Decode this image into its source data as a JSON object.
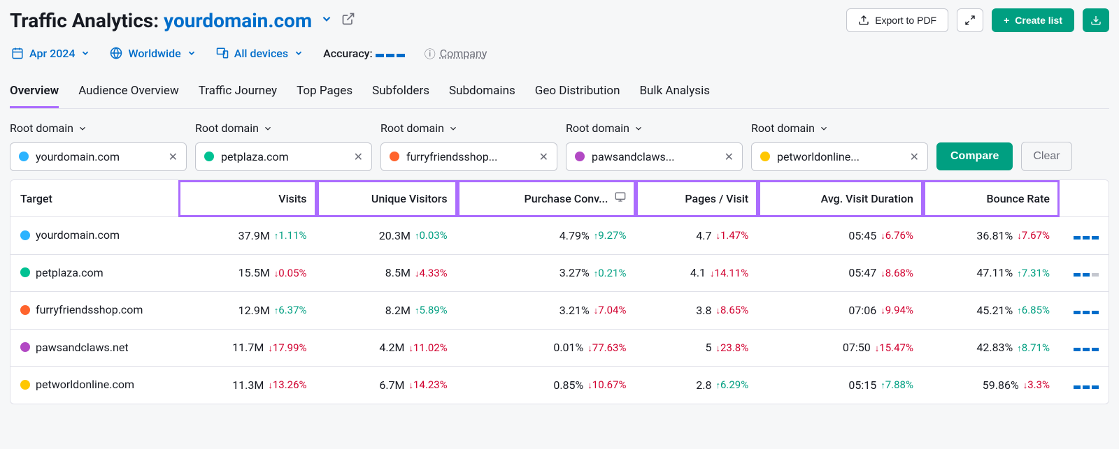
{
  "header": {
    "title_prefix": "Traffic Analytics: ",
    "domain": "yourdomain.com",
    "export_label": "Export to PDF",
    "create_list_label": "Create list"
  },
  "filters": {
    "date": "Apr 2024",
    "region": "Worldwide",
    "devices": "All devices",
    "accuracy_label": "Accuracy:",
    "company_label": "Company"
  },
  "tabs": [
    {
      "label": "Overview",
      "active": true
    },
    {
      "label": "Audience Overview"
    },
    {
      "label": "Traffic Journey"
    },
    {
      "label": "Top Pages"
    },
    {
      "label": "Subfolders"
    },
    {
      "label": "Subdomains"
    },
    {
      "label": "Geo Distribution"
    },
    {
      "label": "Bulk Analysis"
    }
  ],
  "domain_selector": {
    "root_label": "Root domain",
    "chips": [
      {
        "label": "yourdomain.com",
        "color": "#2bb3ff"
      },
      {
        "label": "petplaza.com",
        "color": "#00c192"
      },
      {
        "label": "furryfriendsshop...",
        "color": "#ff642d"
      },
      {
        "label": "pawsandclaws...",
        "color": "#b249c4"
      },
      {
        "label": "petworldonline...",
        "color": "#ffc700"
      }
    ],
    "compare_label": "Compare",
    "clear_label": "Clear"
  },
  "table": {
    "headers": {
      "target": "Target",
      "visits": "Visits",
      "unique": "Unique Visitors",
      "conv": "Purchase Conv...",
      "pages": "Pages / Visit",
      "duration": "Avg. Visit Duration",
      "bounce": "Bounce Rate"
    },
    "rows": [
      {
        "color": "#2bb3ff",
        "domain": "yourdomain.com",
        "visits": {
          "v": "37.9M",
          "d": "1.11%",
          "dir": "up"
        },
        "unique": {
          "v": "20.3M",
          "d": "0.03%",
          "dir": "up"
        },
        "conv": {
          "v": "4.79%",
          "d": "9.27%",
          "dir": "up"
        },
        "pages": {
          "v": "4.7",
          "d": "1.47%",
          "dir": "down"
        },
        "duration": {
          "v": "05:45",
          "d": "6.76%",
          "dir": "down"
        },
        "bounce": {
          "v": "36.81%",
          "d": "7.67%",
          "dir": "down"
        },
        "spark": [
          1,
          1,
          1
        ]
      },
      {
        "color": "#00c192",
        "domain": "petplaza.com",
        "visits": {
          "v": "15.5M",
          "d": "0.05%",
          "dir": "down"
        },
        "unique": {
          "v": "8.5M",
          "d": "4.33%",
          "dir": "down"
        },
        "conv": {
          "v": "3.27%",
          "d": "0.21%",
          "dir": "up"
        },
        "pages": {
          "v": "4.1",
          "d": "14.11%",
          "dir": "down"
        },
        "duration": {
          "v": "05:47",
          "d": "8.68%",
          "dir": "down"
        },
        "bounce": {
          "v": "47.11%",
          "d": "7.31%",
          "dir": "up"
        },
        "spark": [
          1,
          1,
          0
        ]
      },
      {
        "color": "#ff642d",
        "domain": "furryfriendsshop.com",
        "visits": {
          "v": "12.9M",
          "d": "6.37%",
          "dir": "up"
        },
        "unique": {
          "v": "8.2M",
          "d": "5.89%",
          "dir": "up"
        },
        "conv": {
          "v": "3.21%",
          "d": "7.04%",
          "dir": "down"
        },
        "pages": {
          "v": "3.8",
          "d": "8.65%",
          "dir": "down"
        },
        "duration": {
          "v": "07:06",
          "d": "9.94%",
          "dir": "down"
        },
        "bounce": {
          "v": "45.21%",
          "d": "6.85%",
          "dir": "up"
        },
        "spark": [
          1,
          1,
          1
        ]
      },
      {
        "color": "#b249c4",
        "domain": "pawsandclaws.net",
        "visits": {
          "v": "11.7M",
          "d": "17.99%",
          "dir": "down"
        },
        "unique": {
          "v": "4.2M",
          "d": "11.02%",
          "dir": "down"
        },
        "conv": {
          "v": "0.01%",
          "d": "77.63%",
          "dir": "down"
        },
        "pages": {
          "v": "5",
          "d": "23.8%",
          "dir": "down"
        },
        "duration": {
          "v": "07:50",
          "d": "15.47%",
          "dir": "down"
        },
        "bounce": {
          "v": "42.83%",
          "d": "8.71%",
          "dir": "up"
        },
        "spark": [
          1,
          1,
          1
        ]
      },
      {
        "color": "#ffc700",
        "domain": "petworldonline.com",
        "visits": {
          "v": "11.3M",
          "d": "13.26%",
          "dir": "down"
        },
        "unique": {
          "v": "6.7M",
          "d": "14.23%",
          "dir": "down"
        },
        "conv": {
          "v": "0.85%",
          "d": "10.67%",
          "dir": "down"
        },
        "pages": {
          "v": "2.8",
          "d": "6.29%",
          "dir": "up"
        },
        "duration": {
          "v": "05:15",
          "d": "7.88%",
          "dir": "up"
        },
        "bounce": {
          "v": "59.86%",
          "d": "3.3%",
          "dir": "down"
        },
        "spark": [
          1,
          1,
          1
        ]
      }
    ]
  }
}
